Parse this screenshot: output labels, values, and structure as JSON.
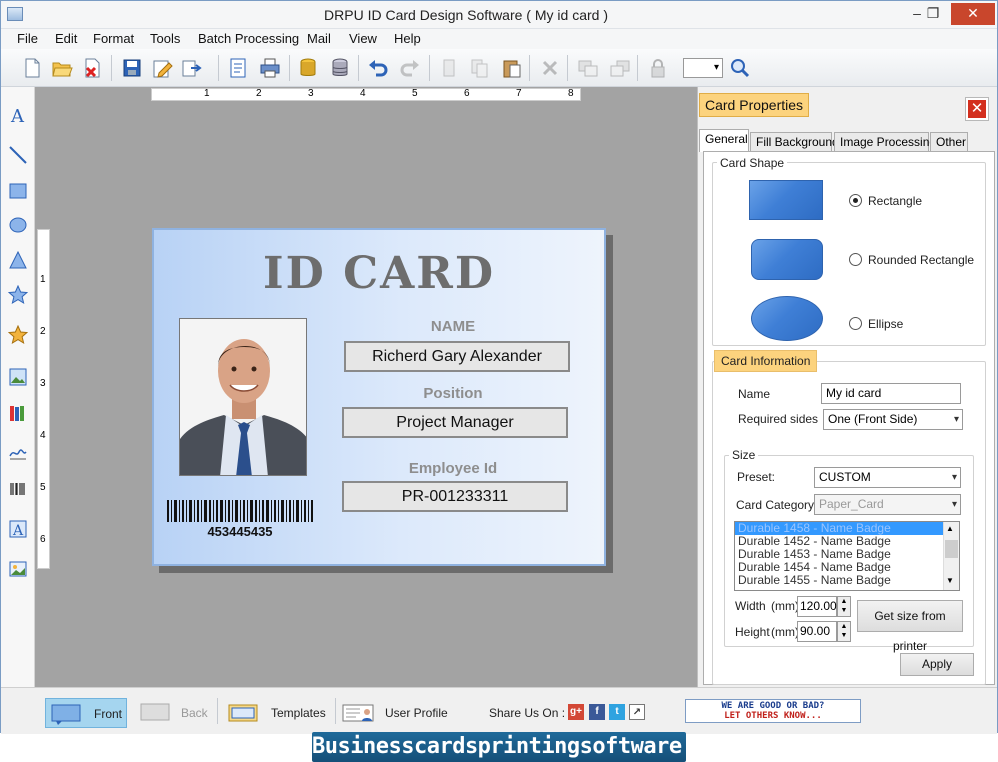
{
  "window": {
    "title": "DRPU ID Card Design Software ( My id card )",
    "minimize": "–",
    "maximize": "❐",
    "close": "✕"
  },
  "menu": [
    "File",
    "Edit",
    "Format",
    "Tools",
    "Batch Processing",
    "Mail",
    "View",
    "Help"
  ],
  "toolbar": {
    "icons": [
      "new-document-icon",
      "open-folder-icon",
      "close-document-icon",
      "save-icon",
      "edit-icon",
      "export-icon",
      "properties-icon",
      "print-icon",
      "database-icon",
      "database-stack-icon",
      "undo-icon",
      "redo-icon",
      "cut-icon",
      "copy-icon",
      "paste-icon",
      "delete-icon",
      "bring-front-icon",
      "send-back-icon",
      "lock-icon",
      "zoom-combo",
      "zoom-in-icon"
    ]
  },
  "left_tools": [
    "text-tool-icon",
    "line-tool-icon",
    "rectangle-tool-icon",
    "ellipse-tool-icon",
    "triangle-tool-icon",
    "star-tool-icon",
    "symbol-tool-icon",
    "image-tool-icon",
    "library-tool-icon",
    "signature-tool-icon",
    "barcode-tool-icon",
    "word-art-tool-icon",
    "picture-tool-icon"
  ],
  "ruler": {
    "horizontal": [
      "1",
      "2",
      "3",
      "4",
      "5",
      "6",
      "7",
      "8"
    ],
    "vertical": [
      "1",
      "2",
      "3",
      "4",
      "5",
      "6"
    ]
  },
  "card": {
    "title": "ID CARD",
    "name_label": "NAME",
    "name_value": "Richerd Gary Alexander",
    "position_label": "Position",
    "position_value": "Project Manager",
    "employee_label": "Employee Id",
    "employee_value": "PR-001233311",
    "barcode_number": "453445435"
  },
  "panel": {
    "title": "Card Properties",
    "tabs": [
      "General",
      "Fill Background",
      "Image Processing",
      "Other"
    ],
    "active_tab": "General",
    "card_shape": {
      "title": "Card Shape",
      "options": [
        "Rectangle",
        "Rounded Rectangle",
        "Ellipse"
      ],
      "selected": "Rectangle"
    },
    "card_information": {
      "title": "Card Information",
      "name_label": "Name",
      "name_value": "My id card",
      "sides_label": "Required sides",
      "sides_value": "One (Front Side)"
    },
    "size": {
      "title": "Size",
      "preset_label": "Preset:",
      "preset_value": "CUSTOM",
      "category_label": "Card Category",
      "category_value": "Paper_Card",
      "list_items": [
        "Durable 1458 - Name Badge",
        "Durable 1452 - Name Badge",
        "Durable 1453 - Name Badge",
        "Durable 1454 - Name Badge",
        "Durable 1455 - Name Badge"
      ],
      "width_label": "Width",
      "width_unit": "(mm)",
      "width_value": "120.00",
      "height_label": "Height",
      "height_unit": "(mm)",
      "height_value": "90.00",
      "printer_button": "Get size from printer",
      "apply_button": "Apply"
    }
  },
  "statusbar": {
    "front": "Front",
    "back": "Back",
    "templates": "Templates",
    "user_profile": "User Profile",
    "share_label": "Share Us On :",
    "feedback_line1": "WE ARE GOOD OR BAD?",
    "feedback_line2": "LET OTHERS KNOW..."
  },
  "banner": "Businesscardsprintingsoftware.com",
  "colors": {
    "close_button": "#c9462c",
    "panel_title_bg": "#fcd37e",
    "active_front": "#a5d5ef",
    "card_gradient_start": "#b8d2f5",
    "banner_bg": "#1f6a9a",
    "selection": "#3399ff"
  }
}
